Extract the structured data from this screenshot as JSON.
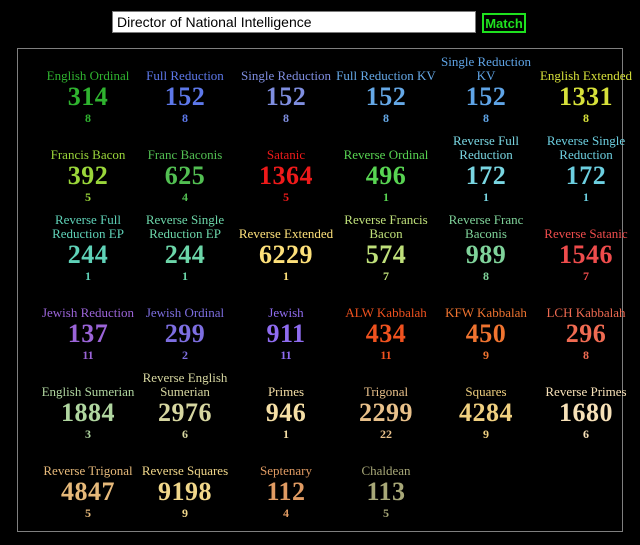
{
  "search": {
    "value": "Director of National Intelligence",
    "button_label": "Match"
  },
  "ciphers": [
    {
      "name": "English Ordinal",
      "value": "314",
      "reduced": "8",
      "color": "#2fb32f"
    },
    {
      "name": "Full Reduction",
      "value": "152",
      "reduced": "8",
      "color": "#5d78ea"
    },
    {
      "name": "Single Reduction",
      "value": "152",
      "reduced": "8",
      "color": "#7f8ee0"
    },
    {
      "name": "Full Reduction KV",
      "value": "152",
      "reduced": "8",
      "color": "#65a8e6"
    },
    {
      "name": "Single Reduction KV",
      "value": "152",
      "reduced": "8",
      "color": "#5fa4e6"
    },
    {
      "name": "English Extended",
      "value": "1331",
      "reduced": "8",
      "color": "#d7e13a"
    },
    {
      "name": "Francis Bacon",
      "value": "392",
      "reduced": "5",
      "color": "#9ad63a"
    },
    {
      "name": "Franc Baconis",
      "value": "625",
      "reduced": "4",
      "color": "#52bf52"
    },
    {
      "name": "Satanic",
      "value": "1364",
      "reduced": "5",
      "color": "#ef1a1a"
    },
    {
      "name": "Reverse Ordinal",
      "value": "496",
      "reduced": "1",
      "color": "#58d452"
    },
    {
      "name": "Reverse Full Reduction",
      "value": "172",
      "reduced": "1",
      "color": "#79d6e2"
    },
    {
      "name": "Reverse Single Reduction",
      "value": "172",
      "reduced": "1",
      "color": "#6ccfe0"
    },
    {
      "name": "Reverse Full Reduction EP",
      "value": "244",
      "reduced": "1",
      "color": "#5fd2b8"
    },
    {
      "name": "Reverse Single Reduction EP",
      "value": "244",
      "reduced": "1",
      "color": "#6cd6a9"
    },
    {
      "name": "Reverse Extended",
      "value": "6229",
      "reduced": "1",
      "color": "#fde07a"
    },
    {
      "name": "Reverse Francis Bacon",
      "value": "574",
      "reduced": "7",
      "color": "#bfe07a"
    },
    {
      "name": "Reverse Franc Baconis",
      "value": "989",
      "reduced": "8",
      "color": "#7fd39a"
    },
    {
      "name": "Reverse Satanic",
      "value": "1546",
      "reduced": "7",
      "color": "#ef4c4c"
    },
    {
      "name": "Jewish Reduction",
      "value": "137",
      "reduced": "11",
      "color": "#9b64d8"
    },
    {
      "name": "Jewish Ordinal",
      "value": "299",
      "reduced": "2",
      "color": "#7d6ee0"
    },
    {
      "name": "Jewish",
      "value": "911",
      "reduced": "11",
      "color": "#8f6cf0"
    },
    {
      "name": "ALW Kabbalah",
      "value": "434",
      "reduced": "11",
      "color": "#f0521f"
    },
    {
      "name": "KFW Kabbalah",
      "value": "450",
      "reduced": "9",
      "color": "#f07430"
    },
    {
      "name": "LCH Kabbalah",
      "value": "296",
      "reduced": "8",
      "color": "#f06b52"
    },
    {
      "name": "English Sumerian",
      "value": "1884",
      "reduced": "3",
      "color": "#b0d6a0"
    },
    {
      "name": "Reverse English Sumerian",
      "value": "2976",
      "reduced": "6",
      "color": "#d6d6a0"
    },
    {
      "name": "Primes",
      "value": "946",
      "reduced": "1",
      "color": "#f5dfa6"
    },
    {
      "name": "Trigonal",
      "value": "2299",
      "reduced": "22",
      "color": "#e8c08a"
    },
    {
      "name": "Squares",
      "value": "4284",
      "reduced": "9",
      "color": "#f0d080"
    },
    {
      "name": "Reverse Primes",
      "value": "1680",
      "reduced": "6",
      "color": "#f7e1b8"
    },
    {
      "name": "Reverse Trigonal",
      "value": "4847",
      "reduced": "5",
      "color": "#e6b97a"
    },
    {
      "name": "Reverse Squares",
      "value": "9198",
      "reduced": "9",
      "color": "#f1d78a"
    },
    {
      "name": "Septenary",
      "value": "112",
      "reduced": "4",
      "color": "#e09b63"
    },
    {
      "name": "Chaldean",
      "value": "113",
      "reduced": "5",
      "color": "#a8a878"
    }
  ]
}
